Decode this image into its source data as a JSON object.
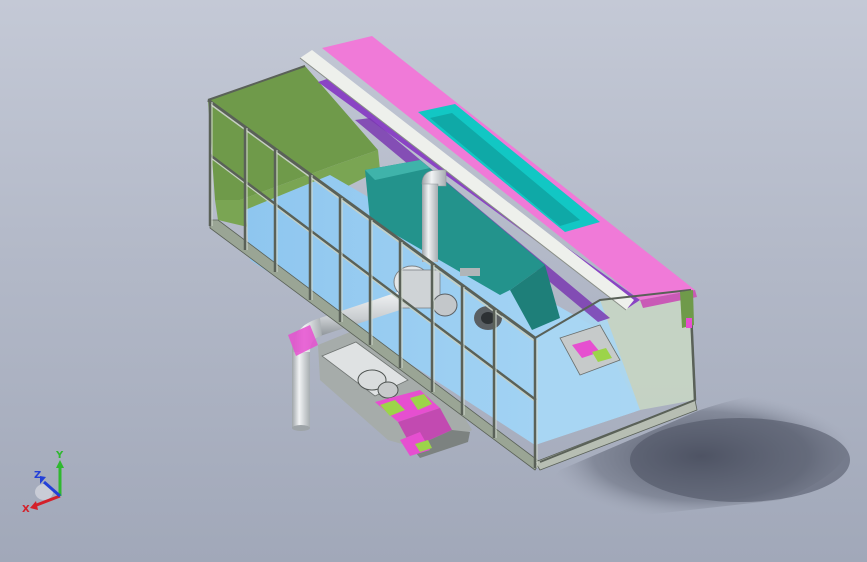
{
  "viewport": {
    "background_top": "#c4c9d6",
    "background_bottom": "#a1a8b9"
  },
  "triad": {
    "x_label": "X",
    "y_label": "Y",
    "z_label": "Z",
    "x_color": "#d4202a",
    "y_color": "#2fb82f",
    "z_color": "#2340d8"
  },
  "model": {
    "name": "",
    "colors": {
      "frame": "#9aa595",
      "green_panel": "#6f9a4a",
      "blue_glass": "#8ec8f2",
      "magenta_top": "#f07ad8",
      "cyan_slot": "#12c7c4",
      "teal_hopper": "#23938c",
      "purple_strip": "#8a44c4",
      "pipe": "#d8dcde",
      "track_magenta": "#e64fd0",
      "track_green": "#9cd44a"
    }
  }
}
